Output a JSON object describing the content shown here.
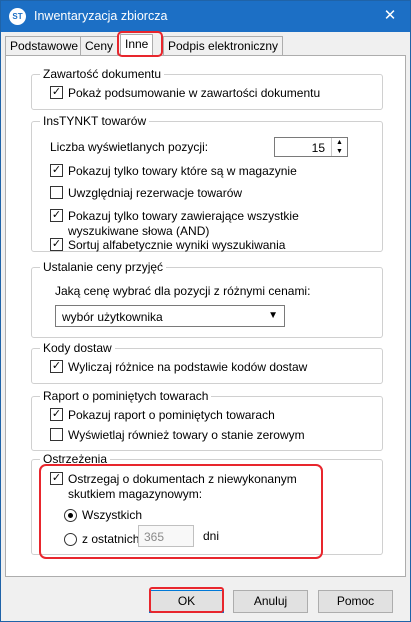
{
  "window": {
    "title": "Inwentaryzacja zbiorcza",
    "icon_text": "ST",
    "close_glyph": "✕"
  },
  "tabs": [
    "Podstawowe",
    "Ceny",
    "Inne",
    "Podpis elektroniczny"
  ],
  "active_tab": "Inne",
  "groups": {
    "zawartosc": {
      "title": "Zawartość dokumentu",
      "show_sign_label": "Pokaż podsumowanie w zawartości dokumentu",
      "show_sign_checked": true
    },
    "instynkt": {
      "title": "InsTYNKT towarów",
      "count_label": "Liczba wyświetlanych pozycji:",
      "count_value": "15",
      "only_in_stock_label": "Pokazuj tylko towary które są w magazynie",
      "only_in_stock_checked": true,
      "reservations_label": "Uwzględniaj rezerwacje towarów",
      "reservations_checked": false,
      "all_words_label": "Pokazuj tylko towary zawierające wszystkie wyszukiwane słowa (AND)",
      "all_words_checked": true,
      "sort_label": "Sortuj alfabetycznie wyniki wyszukiwania",
      "sort_checked": true
    },
    "cena": {
      "title": "Ustalanie ceny przyjęć",
      "question": "Jaką cenę wybrać dla pozycji z różnymi cenami:",
      "select_value": "wybór użytkownika"
    },
    "kody": {
      "title": "Kody dostaw",
      "diff_label": "Wyliczaj różnice na podstawie kodów dostaw",
      "diff_checked": true
    },
    "raport": {
      "title": "Raport o pominiętych towarach",
      "show_report_label": "Pokazuj raport o pominiętych towarach",
      "show_report_checked": true,
      "zero_stock_label": "Wyświetlaj również towary o stanie zerowym",
      "zero_stock_checked": false
    },
    "ostrzezenia": {
      "title": "Ostrzeżenia",
      "warn_label": "Ostrzegaj o dokumentach z niewykonanym skutkiem magazynowym:",
      "warn_checked": true,
      "radio_all_label": "Wszystkich",
      "radio_all_selected": true,
      "radio_last_label": "z ostatnich",
      "radio_last_selected": false,
      "days_value": "365",
      "days_unit": "dni"
    }
  },
  "buttons": {
    "ok": "OK",
    "cancel": "Anuluj",
    "help": "Pomoc"
  },
  "colors": {
    "titlebar": "#1c6fc5",
    "highlight": "#e8262d"
  }
}
